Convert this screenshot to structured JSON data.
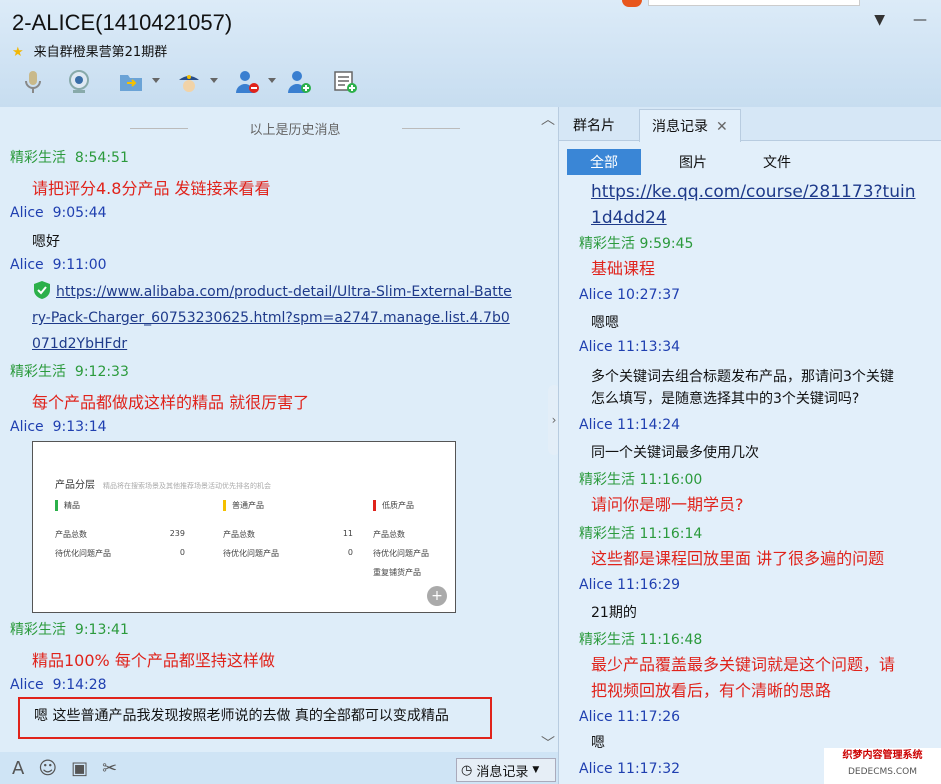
{
  "window": {
    "title": "2-ALICE(1410421057)",
    "subtitle": "来自群橙果营第21期群",
    "minimize": "—",
    "dropdown": "▼"
  },
  "toolbar": {
    "icons": [
      "microphone-icon",
      "camera-icon",
      "folder-icon",
      "police-icon",
      "remove-user-icon",
      "add-user-icon",
      "new-note-icon"
    ]
  },
  "left": {
    "history_label": "以上是历史消息",
    "messages": [
      {
        "sender": "精彩生活",
        "time": "8:54:51",
        "text": "请把评分4.8分产品 发链接来看看"
      },
      {
        "sender": "Alice",
        "time": "9:05:44",
        "text": "嗯好"
      },
      {
        "sender": "Alice",
        "time": "9:11:00",
        "link": "https://www.alibaba.com/product-detail/Ultra-Slim-External-Battery-Pack-Charger_60753230625.html?spm=a2747.manage.list.4.7b0071d2YbHFdr"
      },
      {
        "sender": "精彩生活",
        "time": "9:12:33",
        "text": "每个产品都做成这样的精品 就很厉害了"
      },
      {
        "sender": "Alice",
        "time": "9:13:14"
      },
      {
        "sender": "精彩生活",
        "time": "9:13:41",
        "text": "精品100% 每个产品都坚持这样做"
      },
      {
        "sender": "Alice",
        "time": "9:14:28",
        "text": "嗯 这些普通产品我发现按照老师说的去做 真的全部都可以变成精品"
      }
    ],
    "image": {
      "title": "产品分层",
      "desc": "精品将在搜索场景及其他推荐场景活动优先排名的机会",
      "col1": {
        "name": "精品",
        "r1l": "产品总数",
        "r1v": "239",
        "r2l": "待优化问题产品",
        "r2v": "0"
      },
      "col2": {
        "name": "普通产品",
        "r1l": "产品总数",
        "r1v": "11",
        "r2l": "待优化问题产品",
        "r2v": "0"
      },
      "col3": {
        "name": "低质产品",
        "r1l": "产品总数",
        "r2l": "待优化问题产品",
        "r3l": "重复铺货产品"
      }
    }
  },
  "bottom": {
    "history_button": "消息记录"
  },
  "right": {
    "tabs": [
      "群名片",
      "消息记录"
    ],
    "filters": [
      "全部",
      "图片",
      "文件"
    ],
    "link1": "https://ke.qq.com/course/281173?tuin",
    "link2": "1d4dd24",
    "msgs": [
      {
        "sender": "精彩生活",
        "time": "9:59:45",
        "text": "基础课程"
      },
      {
        "sender": "Alice",
        "time": "10:27:37",
        "text": "嗯嗯"
      },
      {
        "sender": "Alice",
        "time": "11:13:34",
        "text1": "多个关键词去组合标题发布产品，那请问3个关键",
        "text2": "怎么填写，是随意选择其中的3个关键词吗?"
      },
      {
        "sender": "Alice",
        "time": "11:14:24",
        "text": "同一个关键词最多使用几次"
      },
      {
        "sender": "精彩生活",
        "time": "11:16:00",
        "text": "请问你是哪一期学员?"
      },
      {
        "sender": "精彩生活",
        "time": "11:16:14",
        "text": "这些都是课程回放里面 讲了很多遍的问题"
      },
      {
        "sender": "Alice",
        "time": "11:16:29",
        "text": "21期的"
      },
      {
        "sender": "精彩生活",
        "time": "11:16:48",
        "text1": "最少产品覆盖最多关键词就是这个问题，请",
        "text2": "把视频回放看后，有个清晰的思路"
      },
      {
        "sender": "Alice",
        "time": "11:17:26",
        "text": "嗯"
      },
      {
        "sender": "Alice",
        "time": "11:17:32"
      }
    ]
  },
  "watermark": {
    "line1": "织梦内容管理系统",
    "line2": "DEDECMS.COM"
  }
}
